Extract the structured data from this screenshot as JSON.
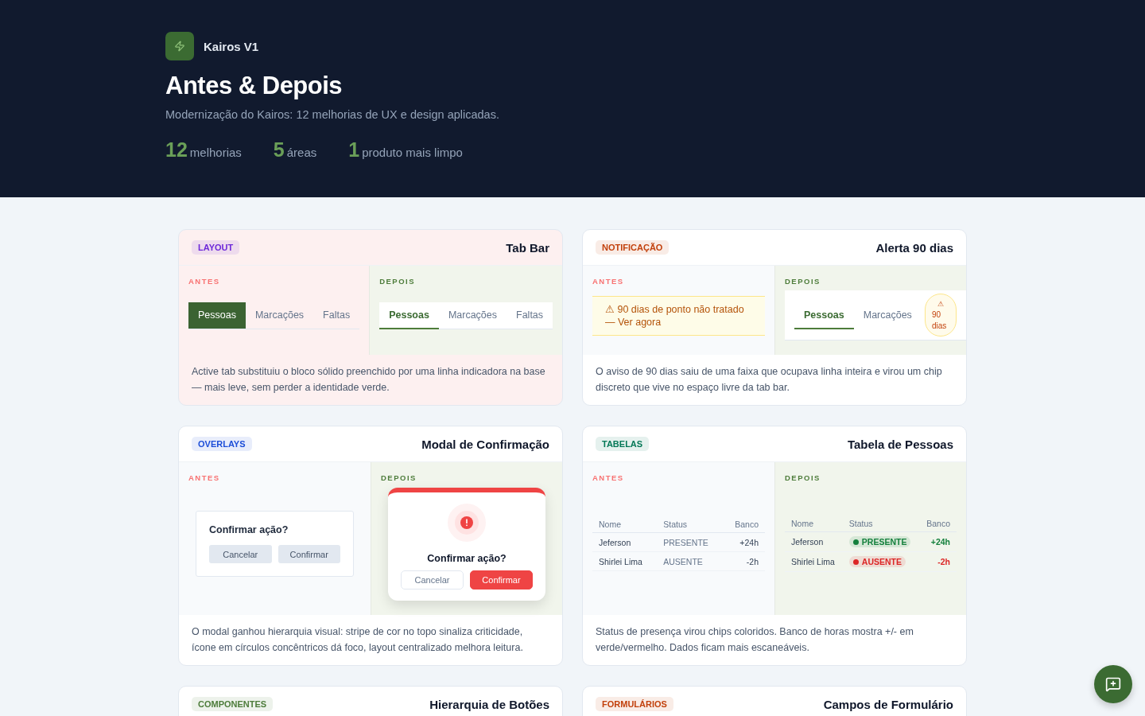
{
  "brand": {
    "name": "Kairos V1"
  },
  "title": "Antes & Depois",
  "subtitle": "Modernização do Kairos: 12 melhorias de UX e design aplicadas.",
  "stats": [
    {
      "value": "12",
      "label": "melhorias"
    },
    {
      "value": "5",
      "label": "áreas"
    },
    {
      "value": "1",
      "label": "produto mais limpo"
    }
  ],
  "cards": [
    {
      "kind": "tabbar",
      "highlighted": true,
      "tag": "LAYOUT",
      "color": "#6d28d9",
      "title": "Tab Bar",
      "before": {
        "label": "ANTES",
        "tabs": [
          {
            "label": "Pessoas",
            "selected": true
          },
          {
            "label": "Marcações",
            "selected": false
          },
          {
            "label": "Faltas",
            "selected": false
          }
        ]
      },
      "after": {
        "label": "DEPOIS",
        "tabs": [
          {
            "label": "Pessoas",
            "selected": true
          },
          {
            "label": "Marcações",
            "selected": false
          },
          {
            "label": "Faltas",
            "selected": false
          }
        ]
      },
      "description": "Active tab substituiu o bloco sólido preenchido por uma linha indicadora na base — mais leve, sem perder a identidade verde."
    },
    {
      "kind": "alert",
      "highlighted": false,
      "tag": "NOTIFICAÇÃO",
      "color": "#c2410c",
      "title": "Alerta 90 dias",
      "before": {
        "label": "ANTES",
        "banner": "⚠ 90 dias de ponto não tratado — Ver agora"
      },
      "after": {
        "label": "DEPOIS",
        "tabs": [
          {
            "label": "Pessoas",
            "selected": true
          },
          {
            "label": "Marcações",
            "selected": false
          }
        ],
        "chip": {
          "icon": "⚠",
          "text": "90 dias"
        }
      },
      "description": "O aviso de 90 dias saiu de uma faixa que ocupava linha inteira e virou um chip discreto que vive no espaço livre da tab bar."
    },
    {
      "kind": "modal",
      "highlighted": false,
      "tag": "OVERLAYS",
      "color": "#1d4ed8",
      "title": "Modal de Confirmação",
      "before": {
        "label": "ANTES",
        "dialog_title": "Confirmar ação?",
        "cancel": "Cancelar",
        "confirm": "Confirmar"
      },
      "after": {
        "label": "DEPOIS",
        "dialog_title": "Confirmar ação?",
        "cancel": "Cancelar",
        "confirm": "Confirmar"
      },
      "description": "O modal ganhou hierarquia visual: stripe de cor no topo sinaliza criticidade, ícone em círculos concêntricos dá foco, layout centralizado melhora leitura."
    },
    {
      "kind": "table",
      "highlighted": false,
      "tag": "TABELAS",
      "color": "#047857",
      "title": "Tabela de Pessoas",
      "before": {
        "label": "ANTES",
        "columns": [
          "Nome",
          "Status",
          "Banco"
        ],
        "rows": [
          {
            "name": "Jeferson",
            "status": "PRESENTE",
            "bank": "+24h"
          },
          {
            "name": "Shirlei Lima",
            "status": "AUSENTE",
            "bank": "-2h"
          }
        ]
      },
      "after": {
        "label": "DEPOIS",
        "columns": [
          "Nome",
          "Status",
          "Banco"
        ],
        "rows": [
          {
            "name": "Jeferson",
            "status": "PRESENTE",
            "bank": "+24h",
            "color": "#15803d"
          },
          {
            "name": "Shirlei Lima",
            "status": "AUSENTE",
            "bank": "-2h",
            "color": "#dc2626"
          }
        ]
      },
      "description": "Status de presença virou chips coloridos. Banco de horas mostra +/- em verde/vermelho. Dados ficam mais escaneáveis."
    },
    {
      "kind": "none",
      "highlighted": false,
      "tag": "COMPONENTES",
      "color": "#4d7c3a",
      "title": "Hierarquia de Botões"
    },
    {
      "kind": "none",
      "highlighted": false,
      "tag": "FORMULÁRIOS",
      "color": "#c2410c",
      "title": "Campos de Formulário"
    }
  ]
}
